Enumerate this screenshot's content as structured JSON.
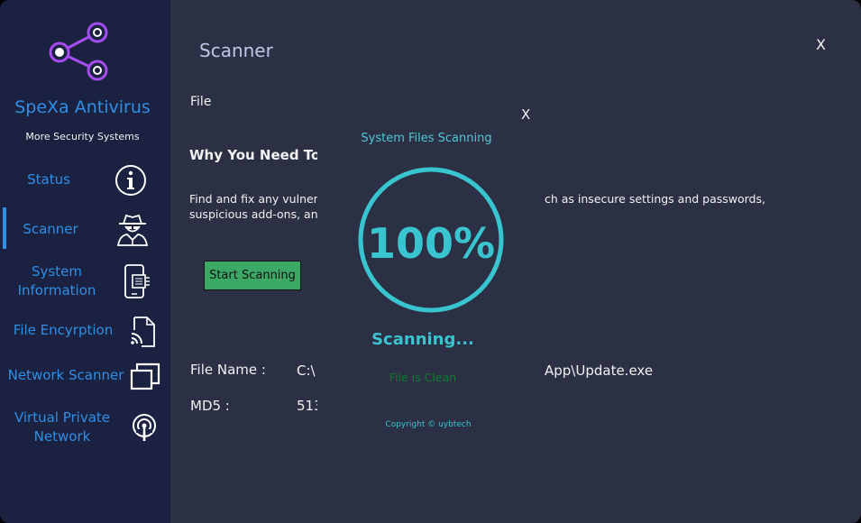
{
  "app": {
    "title": "SpeXa Antivirus",
    "subtitle": "More Security Systems"
  },
  "sidebar": {
    "items": [
      {
        "label": "Status",
        "icon": "info-icon",
        "active": false
      },
      {
        "label": "Scanner",
        "icon": "spy-icon",
        "active": true
      },
      {
        "label": "System Information",
        "line1": "System",
        "line2": "Information",
        "icon": "phone-chip-icon",
        "active": false
      },
      {
        "label": "File Encyrption",
        "icon": "file-cast-icon",
        "active": false
      },
      {
        "label": "Network Scanner",
        "icon": "windows-stack-icon",
        "active": false
      },
      {
        "label": "Virtual Private Network",
        "line1": "Virtual Private",
        "line2": "Network",
        "icon": "broadcast-icon",
        "active": false
      }
    ]
  },
  "main": {
    "title": "Scanner",
    "close_label": "X",
    "file_label": "File",
    "why_heading": "Why You Need To S",
    "description_left_1": "Find and fix any vulnerab",
    "description_left_2": "suspicious add-ons, and",
    "description_right_1": "ch as insecure settings and passwords,",
    "start_button": "Start Scanning",
    "file_name_label": "File Name :",
    "file_name_prefix": "C:\\",
    "file_name_suffix": "App\\Update.exe",
    "md5_label": "MD5 :",
    "md5_value": "513"
  },
  "popup": {
    "close_label": "X",
    "title": "System Files Scanning",
    "progress_percent": 100,
    "progress_text": "100%",
    "status": "Scanning...",
    "result": "File is Clean",
    "copyright": "Copyright © uybtech"
  },
  "colors": {
    "accent_blue": "#2e8fe6",
    "teal": "#38c5cf",
    "sidebar_bg": "#1b2140",
    "main_bg": "#2b3045",
    "button_green": "#3ca865",
    "clean_green": "#137a2c",
    "logo_purple": "#a64df0"
  }
}
